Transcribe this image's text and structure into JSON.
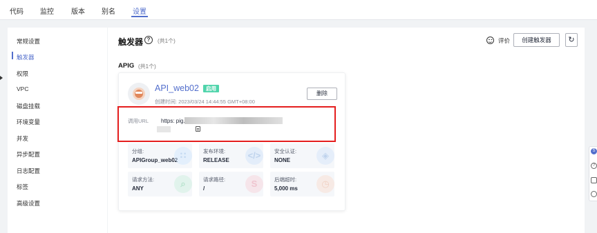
{
  "nav": {
    "tabs": [
      {
        "label": "代码"
      },
      {
        "label": "监控"
      },
      {
        "label": "版本"
      },
      {
        "label": "别名"
      },
      {
        "label": "设置"
      }
    ],
    "active_tab": "设置"
  },
  "sidebar": {
    "items": [
      {
        "label": "常规设置"
      },
      {
        "label": "触发器"
      },
      {
        "label": "权限"
      },
      {
        "label": "VPC"
      },
      {
        "label": "磁盘挂载"
      },
      {
        "label": "环境变量"
      },
      {
        "label": "并发"
      },
      {
        "label": "异步配置"
      },
      {
        "label": "日志配置"
      },
      {
        "label": "标签"
      },
      {
        "label": "高级设置"
      }
    ],
    "active_item": "触发器"
  },
  "header": {
    "title": "触发器",
    "count": "(共1个)",
    "rate_label": "评价",
    "create_button": "创建触发器",
    "refresh_icon": "refresh-icon"
  },
  "section": {
    "title": "APIG",
    "count": "(共1个)"
  },
  "trigger": {
    "name": "API_web02",
    "status": "启用",
    "created": "创建时间:   2023/03/24 14:44:55 GMT+08:00",
    "delete_button": "删除",
    "url_label": "调用URL",
    "url_text": "https:                                                  pig.cn-south-1.huaweicloudapis.com",
    "info": [
      {
        "label": "分组:",
        "value": "APIGroup_web02",
        "icon": "group-icon"
      },
      {
        "label": "发布环境:",
        "value": "RELEASE",
        "icon": "code-icon"
      },
      {
        "label": "安全认证:",
        "value": "NONE",
        "icon": "security-icon"
      },
      {
        "label": "请求方法:",
        "value": "ANY",
        "icon": "method-icon"
      },
      {
        "label": "请求路径:",
        "value": "/",
        "icon": "path-icon"
      },
      {
        "label": "后端超时:",
        "value": "5,000 ms",
        "icon": "timeout-icon"
      }
    ]
  },
  "colors": {
    "accent": "#526ecc",
    "badge": "#50d4ab",
    "highlight": "#e41d1d"
  }
}
